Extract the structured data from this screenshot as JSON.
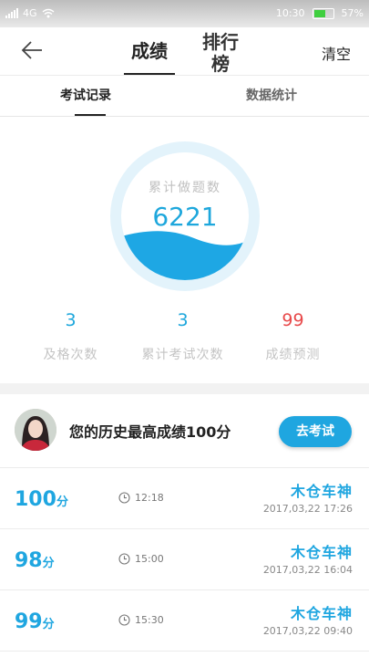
{
  "status_bar": {
    "network": "4G",
    "time": "10:30",
    "battery": "57%"
  },
  "header": {
    "tabs": [
      "成绩",
      "排行榜"
    ],
    "active_tab": 0,
    "clear_label": "清空"
  },
  "sub_tabs": {
    "items": [
      "考试记录",
      "数据统计"
    ],
    "active": 0
  },
  "summary": {
    "circle_title": "累计做题数",
    "circle_value": "6221",
    "stats": [
      {
        "value": "3",
        "label": "及格次数",
        "color": "#1ea7dc"
      },
      {
        "value": "3",
        "label": "累计考试次数",
        "color": "#1ea7dc"
      },
      {
        "value": "99",
        "label": "成绩预测",
        "color": "#e8494a"
      }
    ]
  },
  "best": {
    "text": "您的历史最高成绩100分",
    "button": "去考试"
  },
  "records": [
    {
      "score": "100",
      "unit": "分",
      "duration": "12:18",
      "name": "木仓车神",
      "date": "2017,03,22  17:26"
    },
    {
      "score": "98",
      "unit": "分",
      "duration": "15:00",
      "name": "木仓车神",
      "date": "2017,03,22  16:04"
    },
    {
      "score": "99",
      "unit": "分",
      "duration": "15:30",
      "name": "木仓车神",
      "date": "2017,03,22  09:40"
    }
  ],
  "colors": {
    "accent": "#1fa6e0",
    "predict": "#e8494a"
  },
  "icons": {
    "back": "back-arrow-icon",
    "clock": "clock-icon",
    "wifi": "wifi-icon",
    "battery": "battery-icon"
  }
}
